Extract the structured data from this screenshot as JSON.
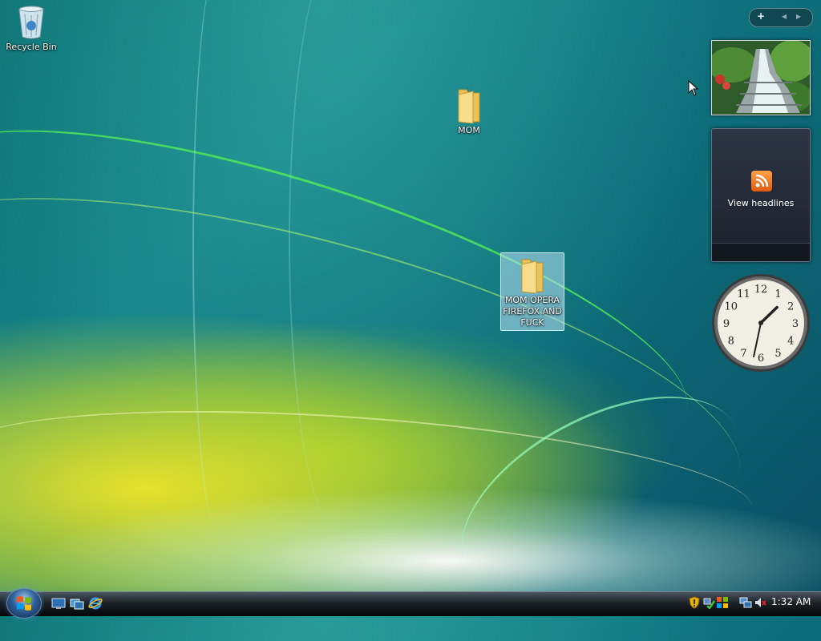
{
  "desktop": {
    "icons": [
      {
        "label": "Recycle Bin",
        "icon": "recycle-bin-icon"
      },
      {
        "label": "MOM",
        "icon": "folder-icon"
      },
      {
        "label": "MOM OPERA FIREFOX AND FUCK",
        "icon": "folder-icon",
        "selected": true
      }
    ]
  },
  "sidebar": {
    "add_label": "+",
    "prev_label": "◂",
    "next_label": "▸",
    "feed_gadget": {
      "label": "View headlines",
      "icon": "rss-icon"
    },
    "clock_gadget": {
      "numerals": [
        "12",
        "1",
        "2",
        "3",
        "4",
        "5",
        "6",
        "7",
        "8",
        "9",
        "10",
        "11"
      ],
      "hour": 1,
      "minute": 32
    }
  },
  "taskbar": {
    "start_icon": "windows-orb-icon",
    "quick_launch": [
      "show-desktop-icon",
      "switch-windows-icon",
      "internet-explorer-icon"
    ],
    "tray_icons": [
      "security-shield-icon",
      "network-icon",
      "windows-update-icon",
      "network-connection-icon",
      "volume-muted-icon"
    ],
    "clock": "1:32 AM"
  },
  "colors": {
    "accent": "#0d7380",
    "taskbar": "#1c2228",
    "selection": "#b9e1f5"
  }
}
